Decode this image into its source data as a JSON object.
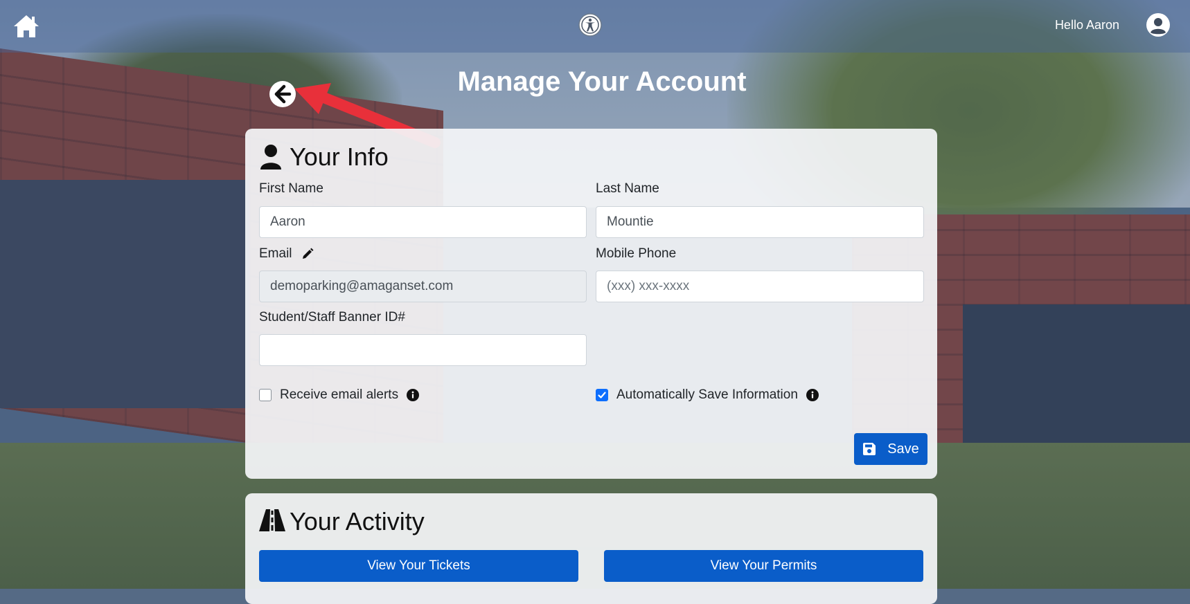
{
  "topbar": {
    "greeting": "Hello Aaron",
    "home_icon": "home-icon",
    "accessibility_icon": "accessibility-icon",
    "user_icon": "user-circle-icon"
  },
  "page": {
    "title": "Manage Your Account",
    "back_icon": "arrow-left-circle-icon"
  },
  "info_card": {
    "title": "Your Info",
    "first_name": {
      "label": "First Name",
      "value": "Aaron"
    },
    "last_name": {
      "label": "Last Name",
      "value": "Mountie"
    },
    "email": {
      "label": "Email",
      "value": "demoparking@amaganset.com"
    },
    "mobile_phone": {
      "label": "Mobile Phone",
      "value": "",
      "placeholder": "(xxx) xxx-xxxx"
    },
    "banner_id": {
      "label": "Student/Staff Banner ID#",
      "value": ""
    },
    "email_alerts": {
      "label": "Receive email alerts",
      "checked": false
    },
    "auto_save": {
      "label": "Automatically Save Information",
      "checked": true
    },
    "save_label": "Save"
  },
  "activity_card": {
    "title": "Your Activity",
    "tickets_label": "View Your Tickets",
    "permits_label": "View Your Permits"
  },
  "colors": {
    "primary": "#0a5dc9",
    "annotation_arrow": "#e8303a"
  }
}
